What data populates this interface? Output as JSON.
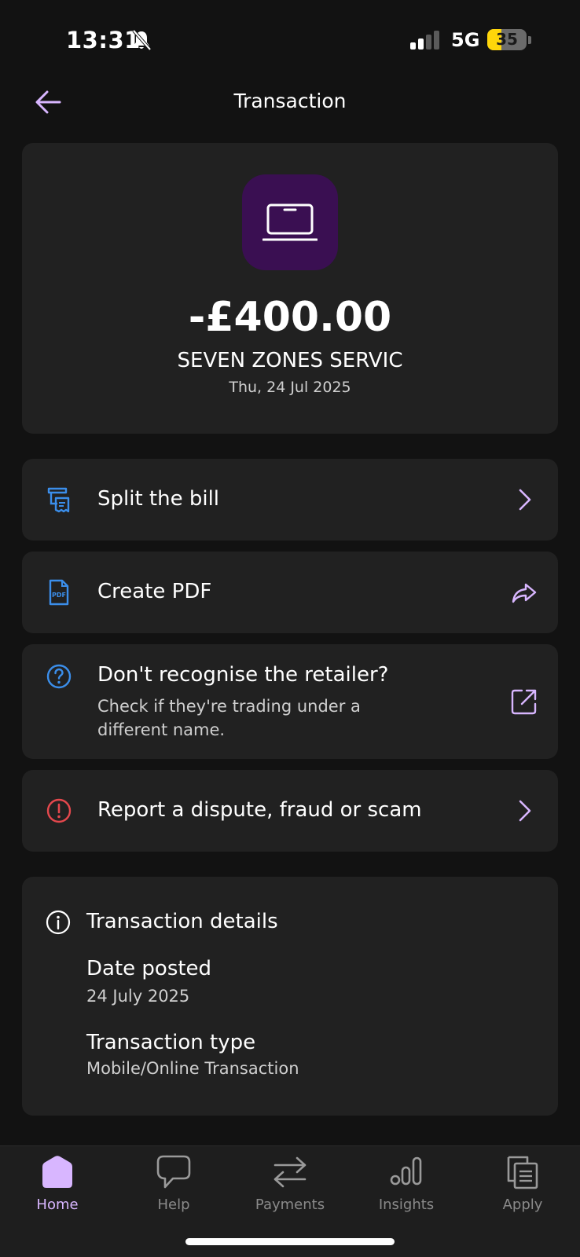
{
  "status_bar": {
    "time": "13:31",
    "network": "5G",
    "battery": "35",
    "battery_level": 0.35,
    "icons": [
      "bell-slash-icon",
      "signal-icon",
      "battery-icon"
    ]
  },
  "header": {
    "title": "Transaction",
    "back_icon": "arrow-left-icon"
  },
  "transaction": {
    "amount": "-£400.00",
    "merchant": "SEVEN ZONES SERVIC",
    "date": "Thu, 24 Jul 2025",
    "merchant_icon": "laptop-icon"
  },
  "actions": [
    {
      "label": "Split the bill",
      "icon": "receipt-split-icon",
      "trail_icon": "chevron-right-icon"
    },
    {
      "label": "Create PDF",
      "icon": "pdf-file-icon",
      "trail_icon": "share-icon"
    },
    {
      "label": "Don't recognise the retailer?",
      "sub": "Check if they're trading under a different name.",
      "icon": "question-circle-icon",
      "trail_icon": "external-link-icon"
    },
    {
      "label": "Report a dispute, fraud or scam",
      "icon": "alert-circle-icon",
      "trail_icon": "chevron-right-icon"
    }
  ],
  "details": {
    "heading": "Transaction details",
    "icon": "info-icon",
    "items": [
      {
        "label": "Date posted",
        "value": "24 July 2025"
      },
      {
        "label": "Transaction type",
        "value": "Mobile/Online Transaction"
      }
    ]
  },
  "bottom_nav": [
    {
      "label": "Home",
      "icon": "home-icon",
      "active": true
    },
    {
      "label": "Help",
      "icon": "chat-bubble-icon",
      "active": false
    },
    {
      "label": "Payments",
      "icon": "transfer-arrows-icon",
      "active": false
    },
    {
      "label": "Insights",
      "icon": "insights-icon",
      "active": false
    },
    {
      "label": "Apply",
      "icon": "documents-icon",
      "active": false
    }
  ],
  "colors": {
    "background": "#121212",
    "card": "#212121",
    "accent": "#d8b6ff",
    "merchant_tile": "#3a0f52",
    "icon_blue": "#3b8eea",
    "alert_red": "#e5484d",
    "battery_yellow": "#ffd60a"
  }
}
